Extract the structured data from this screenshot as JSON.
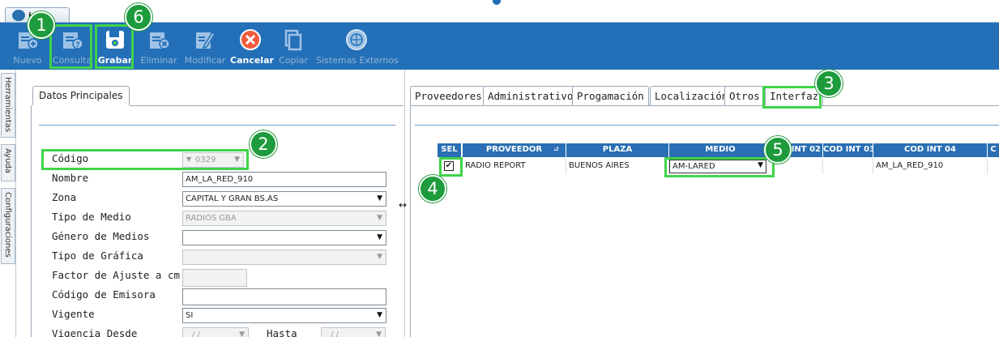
{
  "window": {
    "doc_tab_label": "ios"
  },
  "toolbar": {
    "nuevo": "Nuevo",
    "consulta": "Consulta",
    "grabar": "Grabar",
    "eliminar": "Eliminar",
    "modificar": "Modificar",
    "cancelar": "Cancelar",
    "copiar": "Copiar",
    "sistemas_externos": "Sistemas Externos"
  },
  "side_tabs": [
    "Herramientas",
    "Ayuda",
    "Configuraciones"
  ],
  "left_panel": {
    "tab": "Datos Principales",
    "fields": [
      {
        "label": "Código",
        "value": "0329",
        "disabled": true
      },
      {
        "label": "Nombre",
        "value": "AM_LA_RED_910",
        "disabled": false
      },
      {
        "label": "Zona",
        "value": "CAPITAL Y GRAN BS.AS",
        "disabled": false
      },
      {
        "label": "Tipo de Medio",
        "value": "RADIOS GBA",
        "disabled": true
      },
      {
        "label": "Género de Medios",
        "value": "",
        "disabled": false
      },
      {
        "label": "Tipo de Gráfica",
        "value": "",
        "disabled": true
      },
      {
        "label": "Factor de Ajuste a cm.",
        "value": "",
        "disabled": true
      },
      {
        "label": "Código de Emisora",
        "value": "",
        "disabled": false
      },
      {
        "label": "Vigente",
        "value": "SI",
        "disabled": false
      },
      {
        "label": "Vigencia Desde",
        "value": " / / ",
        "disabled": true
      }
    ],
    "hasta_label": "Hasta",
    "hasta_value": " / / "
  },
  "right_panel": {
    "tabs": [
      "Proveedores",
      "Administrativos",
      "Progamación",
      "Localización",
      "Otros",
      "Interfaz"
    ],
    "grid": {
      "headers": [
        "SEL",
        "PROVEEDOR",
        "PLAZA",
        "MEDIO",
        "INT 02",
        "COD INT 03",
        "COD INT 04",
        "C"
      ],
      "row": {
        "sel_checked": "✔",
        "proveedor": "RADIO REPORT",
        "plaza": "BUENOS AIRES",
        "medio": "AM-LARED",
        "int02": "",
        "cod_int_03": "",
        "cod_int_04": "AM_LA_RED_910",
        "c": ""
      }
    }
  },
  "badges": [
    "1",
    "2",
    "3",
    "4",
    "5",
    "6"
  ],
  "colors": {
    "toolbar": "#2370b8",
    "highlight": "#3fd34a",
    "badge": "#1e9b3c",
    "grid_header": "#2a6fb4"
  }
}
